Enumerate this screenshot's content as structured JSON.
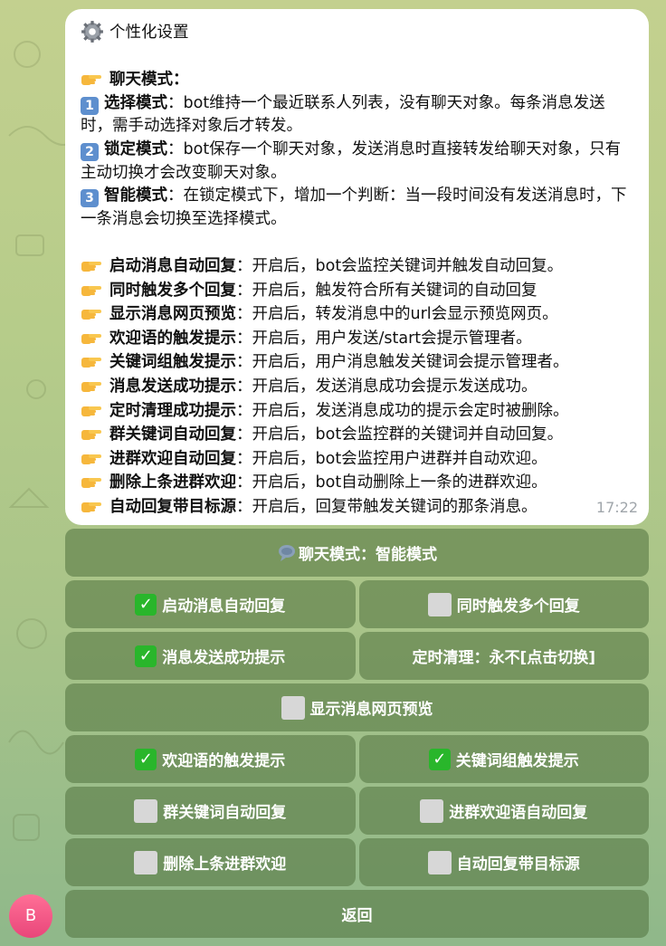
{
  "message": {
    "title": "个性化设置",
    "chat_mode_heading": "聊天模式：",
    "modes": [
      {
        "num": "1",
        "name": "选择模式",
        "desc": "：bot维持一个最近联系人列表，没有聊天对象。每条消息发送时，需手动选择对象后才转发。"
      },
      {
        "num": "2",
        "name": "锁定模式",
        "desc": "：bot保存一个聊天对象，发送消息时直接转发给聊天对象，只有主动切换才会改变聊天对象。"
      },
      {
        "num": "3",
        "name": "智能模式",
        "desc": "：在锁定模式下，增加一个判断：当一段时间没有发送消息时，下一条消息会切换至选择模式。"
      }
    ],
    "features": [
      {
        "name": "启动消息自动回复",
        "desc": "：开启后，bot会监控关键词并触发自动回复。"
      },
      {
        "name": "同时触发多个回复",
        "desc": "：开启后，触发符合所有关键词的自动回复"
      },
      {
        "name": "显示消息网页预览",
        "desc": "：开启后，转发消息中的url会显示预览网页。"
      },
      {
        "name": "欢迎语的触发提示",
        "desc": "：开启后，用户发送/start会提示管理者。"
      },
      {
        "name": "关键词组触发提示",
        "desc": "：开启后，用户消息触发关键词会提示管理者。"
      },
      {
        "name": "消息发送成功提示",
        "desc": "：开启后，发送消息成功会提示发送成功。"
      },
      {
        "name": "定时清理成功提示",
        "desc": "：开启后，发送消息成功的提示会定时被删除。"
      },
      {
        "name": "群关键词自动回复",
        "desc": "：开启后，bot会监控群的关键词并自动回复。"
      },
      {
        "name": "进群欢迎自动回复",
        "desc": "：开启后，bot会监控用户进群并自动欢迎。"
      },
      {
        "name": "删除上条进群欢迎",
        "desc": "：开启后，bot自动删除上一条的进群欢迎。"
      },
      {
        "name": "自动回复带目标源",
        "desc": "：开启后，回复带触发关键词的那条消息。"
      }
    ],
    "time": "17:22"
  },
  "keyboard": {
    "chat_mode_button": "聊天模式：智能模式",
    "rows": [
      [
        {
          "label": "启动消息自动回复",
          "checked": true
        },
        {
          "label": "同时触发多个回复",
          "checked": false
        }
      ],
      [
        {
          "label": "消息发送成功提示",
          "checked": true
        },
        {
          "label": "定时清理：永不[点击切换]",
          "checked": null
        }
      ],
      [
        {
          "label": "显示消息网页预览",
          "checked": false
        }
      ],
      [
        {
          "label": "欢迎语的触发提示",
          "checked": true
        },
        {
          "label": "关键词组触发提示",
          "checked": true
        }
      ],
      [
        {
          "label": "群关键词自动回复",
          "checked": false
        },
        {
          "label": "进群欢迎语自动回复",
          "checked": false
        }
      ],
      [
        {
          "label": "删除上条进群欢迎",
          "checked": false
        },
        {
          "label": "自动回复带目标源",
          "checked": false
        }
      ]
    ],
    "back_button": "返回"
  },
  "avatar": {
    "letter": "B"
  },
  "icons": {
    "title": "gear-icon",
    "bullet": "pointing-hand-icon",
    "chat_mode": "speech-balloon-icon",
    "checked": "checkmark-icon",
    "unchecked": "empty-box-icon"
  },
  "colors": {
    "button_bg": "#547542",
    "checked_bg": "#29b62b",
    "number_badge": "#5e8fce",
    "avatar": "#f05a87"
  }
}
